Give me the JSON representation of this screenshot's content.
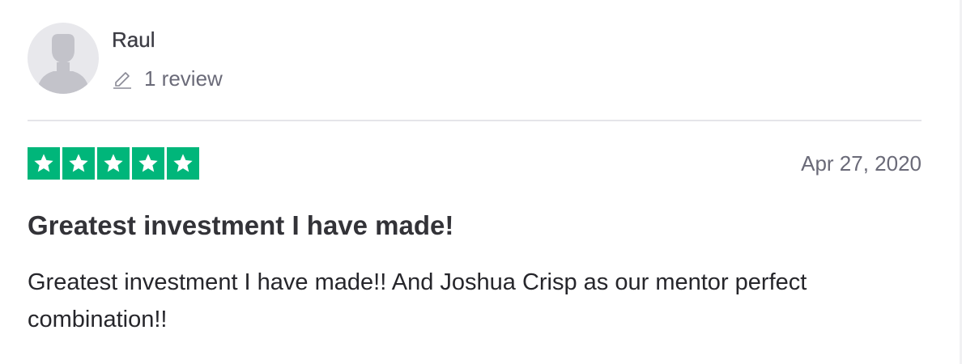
{
  "consumer": {
    "name": "Raul",
    "review_count_label": "1 review",
    "avatar_icon": "default-user-silhouette-icon",
    "review_count_icon": "pencil-icon"
  },
  "review": {
    "rating": 5,
    "max_rating": 5,
    "date": "Apr 27, 2020",
    "title": "Greatest investment I have made!",
    "body": "Greatest investment I have made!! And Joshua Crisp as our mentor perfect combination!!"
  },
  "colors": {
    "star_fill": "#00b67a",
    "star_glyph": "#ffffff",
    "muted_text": "#6a6a78",
    "avatar_bg": "#e8e8ec",
    "avatar_silhouette": "#c3c3ca"
  }
}
